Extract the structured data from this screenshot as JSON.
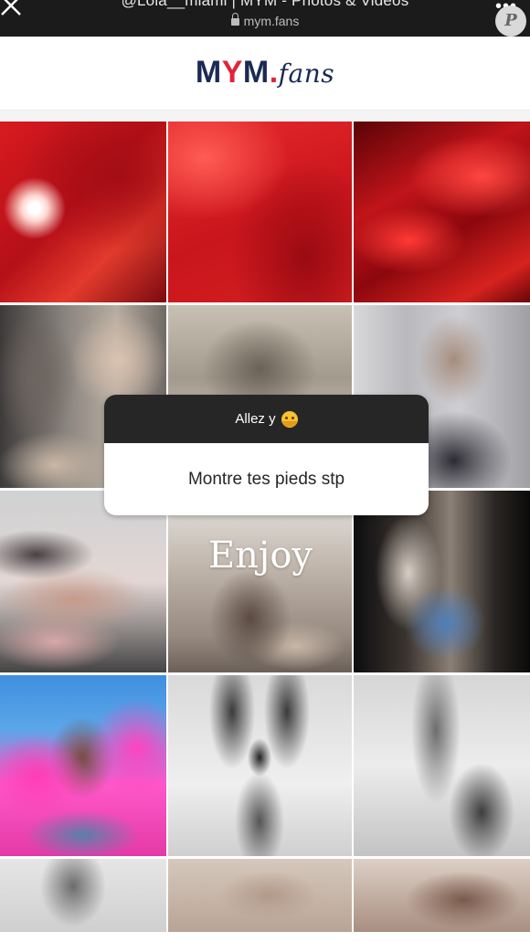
{
  "browser": {
    "title": "@Lola__miami | MYM - Photos & Videos",
    "url": "mym.fans",
    "profile_initial": "P"
  },
  "header": {
    "logo_part1": "M",
    "logo_y": "Y",
    "logo_part2": "M",
    "logo_dot": ".",
    "logo_fans": "fans"
  },
  "sticker": {
    "question": "Allez y",
    "question_emoji": "hugging-face-emoji",
    "answer": "Montre tes pieds stp"
  },
  "overlay_text": "Enjoy",
  "colors": {
    "brand_navy": "#1a2a54",
    "brand_red": "#e0243a",
    "sticker_header": "#262626"
  }
}
